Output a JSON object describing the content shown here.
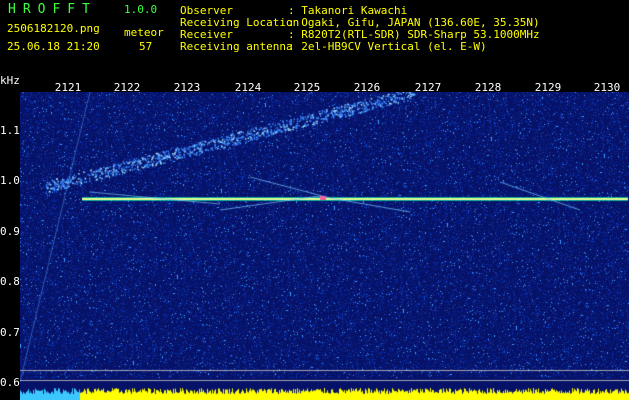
{
  "header": {
    "app_title": "HROFFT",
    "version": "1.0.0",
    "filename": "2506182120.png",
    "meteor_label": "meteor",
    "datetime": "25.06.18 21:20",
    "meteor_count": "57"
  },
  "station": {
    "labels": "Observer\nReceiving Location\nReceiver\nReceiving antenna",
    "values": ": Takanori Kawachi\n: Ogaki, Gifu, JAPAN (136.60E, 35.35N)\n: R820T2(RTL-SDR) SDR-Sharp 53.1000MHz\n: 2el-HB9CV Vertical (el. E-W)"
  },
  "axis": {
    "unit": "kHz",
    "y_ticks": [
      "1.1",
      "1.0",
      "0.9",
      "0.8",
      "0.7",
      "0.6"
    ],
    "x_ticks": [
      "2121",
      "2122",
      "2123",
      "2124",
      "2125",
      "2126",
      "2127",
      "2128",
      "2129",
      "2130"
    ]
  },
  "colors": {
    "title_green": "#3cff3c",
    "text_yellow": "#ffff00",
    "background_blue": "#0a1a7a",
    "carrier": "#e8ff90",
    "baseline_bar": "#ffff00"
  }
}
